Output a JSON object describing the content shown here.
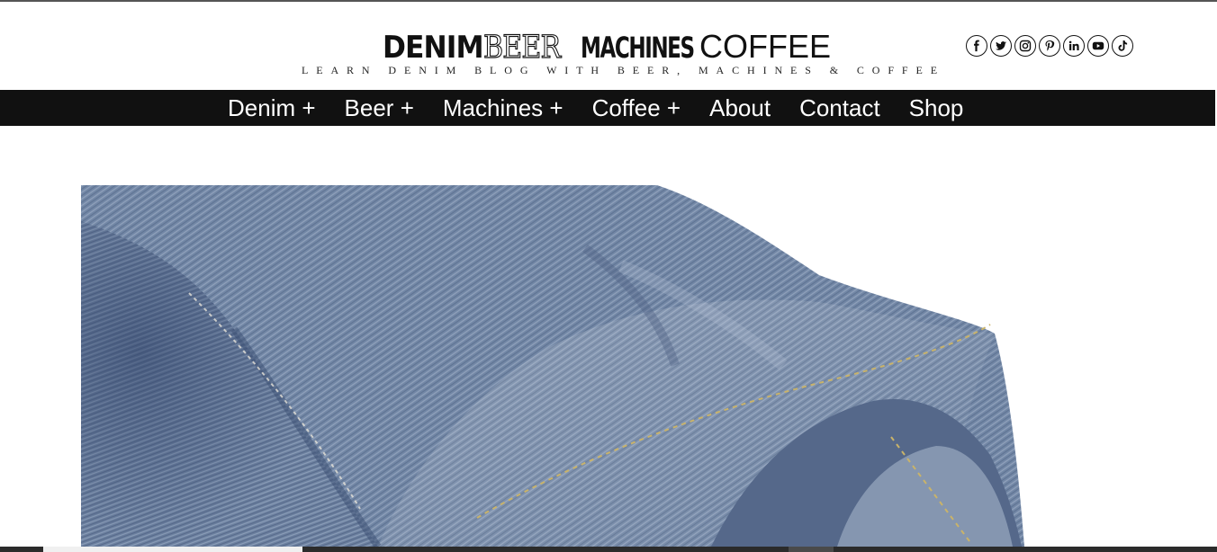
{
  "header": {
    "logo": {
      "word1": "DENIM",
      "word2": "BEER",
      "word3": "MACHINES",
      "word4": "COFFEE"
    },
    "tagline": "LEARN DENIM BLOG WITH BEER, MACHINES & COFFEE",
    "social_icons": [
      "facebook-icon",
      "twitter-icon",
      "instagram-icon",
      "pinterest-icon",
      "linkedin-icon",
      "youtube-icon",
      "tiktok-icon"
    ]
  },
  "nav": {
    "items": [
      {
        "label": "Denim +"
      },
      {
        "label": "Beer +"
      },
      {
        "label": "Machines +"
      },
      {
        "label": "Coffee +"
      },
      {
        "label": "About"
      },
      {
        "label": "Contact"
      },
      {
        "label": "Shop"
      }
    ]
  },
  "colors": {
    "nav_background": "#111111",
    "nav_text": "#ffffff",
    "denim_blue": "#6f84a3"
  }
}
